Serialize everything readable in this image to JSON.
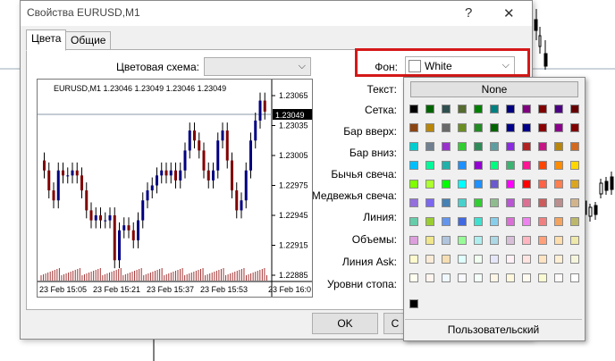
{
  "window": {
    "title": "Свойства EURUSD,M1",
    "help": "?",
    "close": "✕"
  },
  "tabs": [
    {
      "label": "Цвета",
      "active": true
    },
    {
      "label": "Общие",
      "active": false
    }
  ],
  "color_scheme": {
    "label": "Цветовая схема:",
    "value": ""
  },
  "background": {
    "label": "Фон:",
    "value": "White",
    "swatch": "#ffffff"
  },
  "preview": {
    "header": "EURUSD,M1  1.23046 1.23049 1.23046 1.23049",
    "price_badge": "1.23049",
    "price_ticks": [
      "1.23065",
      "1.23035",
      "1.23005",
      "1.22975",
      "1.22945",
      "1.22915",
      "1.22885"
    ],
    "time_ticks": [
      "23 Feb 15:05",
      "23 Feb 15:21",
      "23 Feb 15:37",
      "23 Feb 15:53",
      "23 Feb 16:0"
    ],
    "bull_color": "#000080",
    "bear_color": "#800000",
    "line_color": "#000000",
    "volume_color": "#a33333"
  },
  "element_labels": [
    "Текст:",
    "Сетка:",
    "Бар вверх:",
    "Бар вниз:",
    "Бычья свеча:",
    "Медвежья свеча:",
    "Линия:",
    "Объемы:",
    "Линия Ask:",
    "Уровни стопа:"
  ],
  "buttons": {
    "ok": "OK",
    "cancel": "C"
  },
  "palette": {
    "none_label": "None",
    "custom_label": "Пользовательский",
    "rows": [
      [
        "#000000",
        "#006400",
        "#2f4f4f",
        "#556b2f",
        "#008000",
        "#008080",
        "#000080",
        "#800080",
        "#800000",
        "#4b0082",
        "#660000"
      ],
      [
        "#8b4513",
        "#b8860b",
        "#696969",
        "#6b8e23",
        "#228b22",
        "#006400",
        "#00008b",
        "#00008b",
        "#8b0000",
        "#8b008b",
        "#800000"
      ],
      [
        "#00ced1",
        "#708090",
        "#9932cc",
        "#32cd32",
        "#2e8b57",
        "#5f9ea0",
        "#8a2be2",
        "#b22222",
        "#c71585",
        "#b8860b",
        "#d2691e"
      ],
      [
        "#00bfff",
        "#00fa9a",
        "#20b2aa",
        "#1e90ff",
        "#9400d3",
        "#00ff7f",
        "#3cb371",
        "#ff1493",
        "#ff4500",
        "#ff8c00",
        "#ffd700"
      ],
      [
        "#7fff00",
        "#adff2f",
        "#00ff00",
        "#00ffff",
        "#1e90ff",
        "#6a5acd",
        "#ff00ff",
        "#ff0000",
        "#ff6347",
        "#ff7f50",
        "#daa520"
      ],
      [
        "#9370db",
        "#7b68ee",
        "#4682b4",
        "#48d1cc",
        "#32cd32",
        "#8fbc8f",
        "#ba55d3",
        "#db7093",
        "#cd5c5c",
        "#bc8f8f",
        "#d2b48c"
      ],
      [
        "#66cdaa",
        "#9acd32",
        "#6495ed",
        "#4169e1",
        "#40e0d0",
        "#87ceeb",
        "#da70d6",
        "#ee82ee",
        "#f08080",
        "#f4a460",
        "#bdb76b"
      ],
      [
        "#dda0dd",
        "#f0e68c",
        "#b0c4de",
        "#98fb98",
        "#afeeee",
        "#add8e6",
        "#d8bfd8",
        "#ffb6c1",
        "#ffa07a",
        "#ffdead",
        "#eee8aa"
      ],
      [
        "#fffacd",
        "#faebd7",
        "#f5deb3",
        "#e0ffff",
        "#f0fff0",
        "#e6e6fa",
        "#fff0f5",
        "#ffe4e1",
        "#ffe4c4",
        "#ffefd5",
        "#f5f5dc"
      ],
      [
        "#fffff0",
        "#fff5ee",
        "#f0f8ff",
        "#f8f8ff",
        "#f5fffa",
        "#fdf5e6",
        "#fff8dc",
        "#fffaf0",
        "#fafad2",
        "#fffafa",
        "#ffffff"
      ],
      [
        "#000000"
      ]
    ]
  }
}
